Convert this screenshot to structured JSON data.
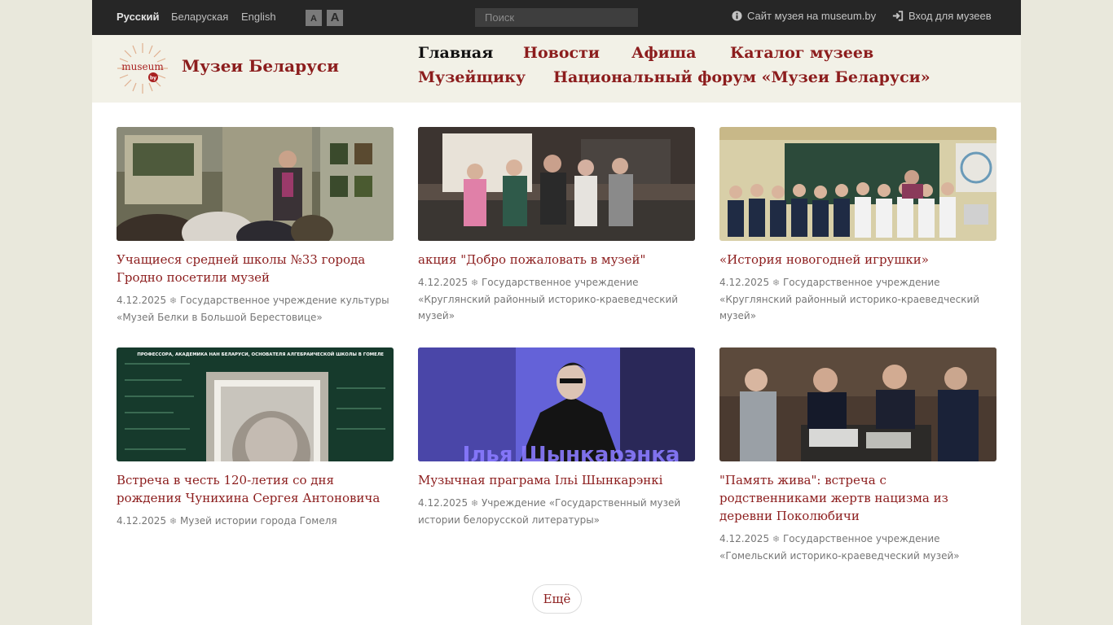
{
  "topbar": {
    "languages": [
      "Русский",
      "Беларуская",
      "English"
    ],
    "font_small": "A",
    "font_large": "A",
    "search_placeholder": "Поиск",
    "site_link": "Сайт музея на museum.by",
    "login_link": "Вход для музеев",
    "icons": [
      "info-icon",
      "sign-in-icon"
    ]
  },
  "header": {
    "logo_text": "museum",
    "logo_suffix": "by",
    "site_name": "Музеи Беларуси",
    "nav": [
      "Главная",
      "Новости",
      "Афиша",
      "Каталог музеев",
      "Музейщику",
      "Национальный форум «Музеи Беларуси»"
    ]
  },
  "colors": {
    "accent": "#8c1d1d",
    "topbar": "#262626",
    "header": "#f2f1e7",
    "background": "#e9e8dc"
  },
  "cards": [
    {
      "title": "Учащиеся средней школы №33 города Гродно посетили музей",
      "date": "4.12.2025",
      "museum": "Государственное учреждение культуры «Музей Белки в Большой Берестовице»"
    },
    {
      "title": "акция \"Добро пожаловать в музей\"",
      "date": "4.12.2025",
      "museum": "Государственное учреждение «Круглянский районный историко-краеведческий музей»"
    },
    {
      "title": "«История новогодней игрушки»",
      "date": "4.12.2025",
      "museum": "Государственное учреждение «Круглянский районный историко-краеведческий музей»"
    },
    {
      "title": "Встреча в честь 120-летия со дня рождения Чунихина Сергея Антоновича",
      "date": "4.12.2025",
      "museum": "Музей истории города Гомеля"
    },
    {
      "title": "Музычная праграма Ільі Шынкарэнкі",
      "date": "4.12.2025",
      "museum": "Учреждение «Государственный музей истории белорусской литературы»"
    },
    {
      "title": "\"Память жива\": встреча с родственниками жертв нацизма из деревни Поколюбичи",
      "date": "4.12.2025",
      "museum": "Государственное учреждение «Гомельский историко-краеведческий музей»"
    }
  ],
  "image_text": {
    "card4_banner": "ПРОФЕССОРА, АКАДЕМИКА НАН БЕЛАРУСИ, ОСНОВАТЕЛЯ АЛГЕБРАИЧЕСКОЙ ШКОЛЫ В ГОМЕЛЕ",
    "card5_name": "Ілья Шынкарэнка"
  },
  "more_button": "Ещё"
}
